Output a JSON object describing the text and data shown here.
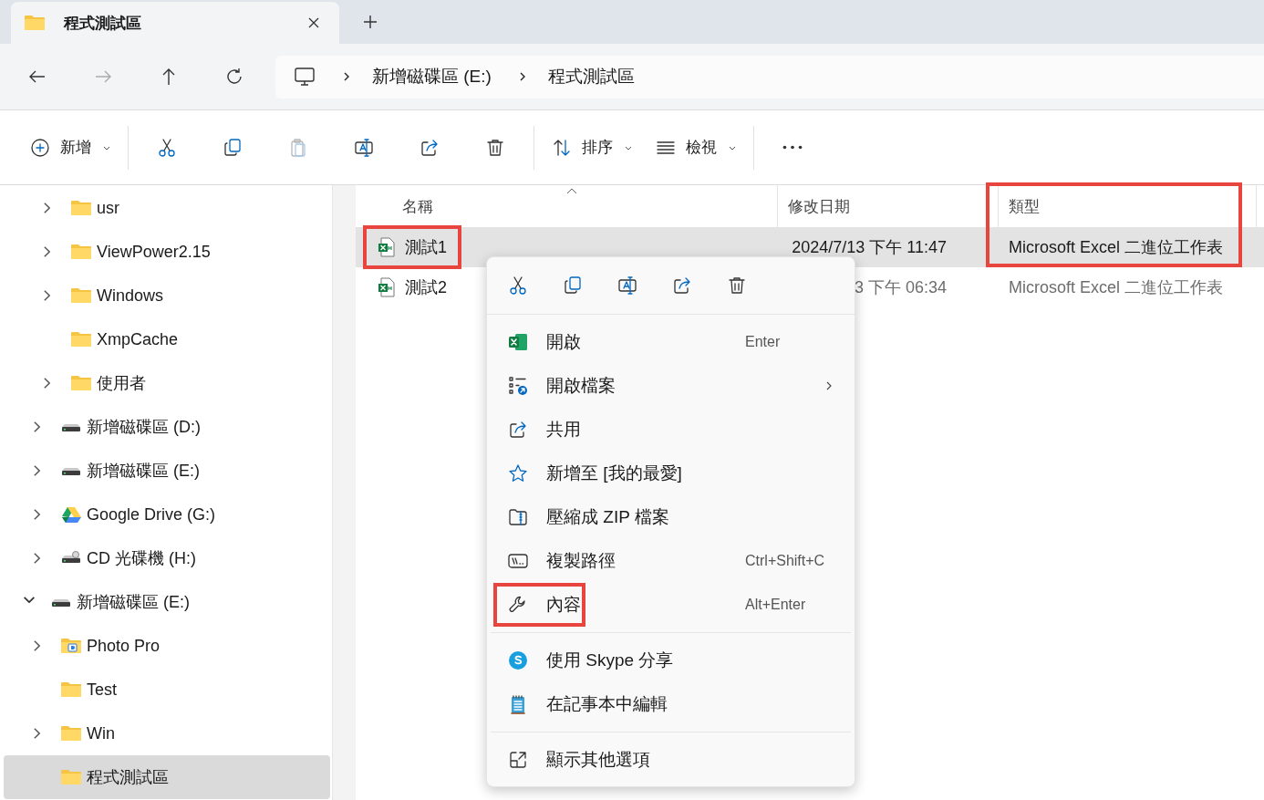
{
  "tab": {
    "title": "程式測試區",
    "selected": true
  },
  "address": {
    "segments": [
      "新增磁碟區 (E:)",
      "程式測試區"
    ]
  },
  "toolbar": [
    {
      "kind": "new",
      "label": "新增",
      "disabled": false
    },
    {
      "kind": "separator"
    },
    {
      "kind": "cut",
      "disabled": false
    },
    {
      "kind": "copy",
      "disabled": false
    },
    {
      "kind": "paste",
      "disabled": true
    },
    {
      "kind": "rename",
      "disabled": false
    },
    {
      "kind": "share",
      "disabled": false
    },
    {
      "kind": "delete",
      "disabled": false
    },
    {
      "kind": "separator"
    },
    {
      "kind": "sort",
      "label": "排序",
      "disabled": false
    },
    {
      "kind": "view",
      "label": "檢視",
      "disabled": false
    },
    {
      "kind": "separator"
    },
    {
      "kind": "more",
      "disabled": false
    }
  ],
  "sidebar": {
    "hidden_parent_items": [
      {
        "label": "usr",
        "kind": "folder",
        "expandable": true,
        "selected": false
      },
      {
        "label": "ViewPower2.15",
        "kind": "folder",
        "expandable": true,
        "selected": false
      },
      {
        "label": "Windows",
        "kind": "folder",
        "expandable": true,
        "selected": false
      },
      {
        "label": "XmpCache",
        "kind": "folder",
        "expandable": false,
        "selected": false
      },
      {
        "label": "使用者",
        "kind": "folder",
        "expandable": true,
        "selected": false
      }
    ],
    "this_pc_items": [
      {
        "label": "新增磁碟區 (D:)",
        "kind": "drive",
        "expandable": true,
        "selected": false
      },
      {
        "label": "新增磁碟區 (E:)",
        "kind": "drive",
        "expandable": true,
        "selected": false
      },
      {
        "label": "Google Drive (G:)",
        "kind": "google_drive",
        "expandable": true,
        "selected": false
      },
      {
        "label": "CD 光碟機 (H:)",
        "kind": "cd_drive",
        "expandable": true,
        "selected": false
      }
    ],
    "items": [
      {
        "label": "新增磁碟區 (E:)",
        "kind": "drive",
        "expandable": true,
        "expanded": true,
        "selected": false,
        "children": [
          {
            "label": "Photo Pro",
            "kind": "app_folder",
            "expandable": true,
            "selected": false
          },
          {
            "label": "Test",
            "kind": "folder",
            "expandable": false,
            "selected": false
          },
          {
            "label": "Win",
            "kind": "folder",
            "expandable": true,
            "selected": false
          },
          {
            "label": "程式測試區",
            "kind": "folder",
            "expandable": false,
            "selected": true
          }
        ]
      }
    ]
  },
  "files": {
    "columns": [
      {
        "label": "名稱",
        "sorted": true,
        "highlighted": false
      },
      {
        "label": "修改日期",
        "sorted": false,
        "highlighted": false
      },
      {
        "label": "類型",
        "sorted": false,
        "highlighted": true
      }
    ],
    "rows": [
      {
        "name": "測試1",
        "modified": "2024/7/13 下午 11:47",
        "type": "Microsoft Excel 二進位工作表",
        "selected": true,
        "name_highlighted": true,
        "type_highlighted": true
      },
      {
        "name": "測試2",
        "modified": "3 下午 06:34",
        "type": "Microsoft Excel 二進位工作表",
        "selected": false,
        "name_highlighted": false,
        "type_highlighted": false
      }
    ]
  },
  "context_menu": {
    "quick_actions": [
      {
        "kind": "cut"
      },
      {
        "kind": "copy"
      },
      {
        "kind": "rename"
      },
      {
        "kind": "share"
      },
      {
        "kind": "delete"
      }
    ],
    "items": [
      {
        "kind": "open",
        "label": "開啟",
        "shortcut": "Enter",
        "submenu": false,
        "highlighted": false
      },
      {
        "kind": "open_with",
        "label": "開啟檔案",
        "submenu": true,
        "highlighted": false
      },
      {
        "kind": "share",
        "label": "共用",
        "submenu": false,
        "highlighted": false
      },
      {
        "kind": "favorite",
        "label": "新增至 [我的最愛]",
        "submenu": false,
        "highlighted": false
      },
      {
        "kind": "zip",
        "label": "壓縮成 ZIP 檔案",
        "submenu": false,
        "highlighted": false
      },
      {
        "kind": "copy_path",
        "label": "複製路徑",
        "shortcut": "Ctrl+Shift+C",
        "submenu": false,
        "highlighted": false
      },
      {
        "kind": "properties",
        "label": "內容",
        "shortcut": "Alt+Enter",
        "submenu": false,
        "highlighted": true
      },
      {
        "kind": "separator"
      },
      {
        "kind": "skype",
        "label": "使用 Skype 分享",
        "submenu": false,
        "highlighted": false
      },
      {
        "kind": "notepad",
        "label": "在記事本中編輯",
        "submenu": false,
        "highlighted": false
      },
      {
        "kind": "separator"
      },
      {
        "kind": "more_options",
        "label": "顯示其他選項",
        "submenu": false,
        "highlighted": false
      }
    ]
  }
}
